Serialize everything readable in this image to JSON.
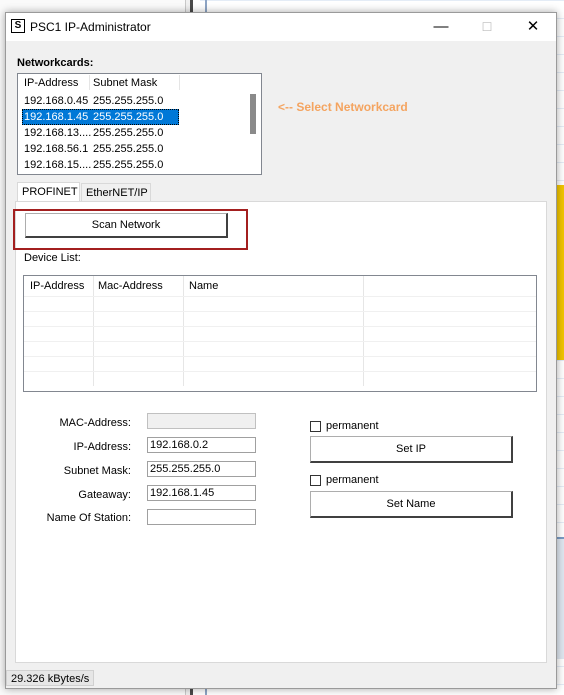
{
  "window": {
    "title": "PSC1 IP-Administrator",
    "icon_text": "S",
    "minimize_glyph": "—",
    "maximize_glyph": "☐",
    "close_glyph": "✕"
  },
  "networkcards": {
    "label": "Networkcards:",
    "columns": [
      "IP-Address",
      "Subnet Mask"
    ],
    "rows": [
      {
        "ip": "192.168.0.45",
        "mask": "255.255.255.0",
        "selected": false
      },
      {
        "ip": "192.168.1.45",
        "mask": "255.255.255.0",
        "selected": true
      },
      {
        "ip": "192.168.13....",
        "mask": "255.255.255.0",
        "selected": false
      },
      {
        "ip": "192.168.56.1",
        "mask": "255.255.255.0",
        "selected": false
      },
      {
        "ip": "192.168.15....",
        "mask": "255.255.255.0",
        "selected": false
      }
    ],
    "hint": "<-- Select Networkcard"
  },
  "tabs": [
    {
      "label": "PROFINET",
      "active": true
    },
    {
      "label": "EtherNET/IP",
      "active": false
    }
  ],
  "profinet": {
    "scan_button": "Scan Network",
    "device_list_label": "Device List:",
    "device_columns": [
      "IP-Address",
      "Mac-Address",
      "Name"
    ],
    "fields": {
      "mac_label": "MAC-Address:",
      "mac_value": "",
      "ip_label": "IP-Address:",
      "ip_value": "192.168.0.2",
      "subnet_label": "Subnet Mask:",
      "subnet_value": "255.255.255.0",
      "gateway_label": "Gateaway:",
      "gateway_value": "192.168.1.45",
      "station_label": "Name Of Station:",
      "station_value": ""
    },
    "permanent_label_1": "permanent",
    "set_ip_button": "Set IP",
    "permanent_label_2": "permanent",
    "set_name_button": "Set Name"
  },
  "status": {
    "speed": "29.326 kBytes/s"
  },
  "colors": {
    "selection": "#0078d7",
    "hint": "#f4a460",
    "highlight_box": "#a31f1f"
  }
}
